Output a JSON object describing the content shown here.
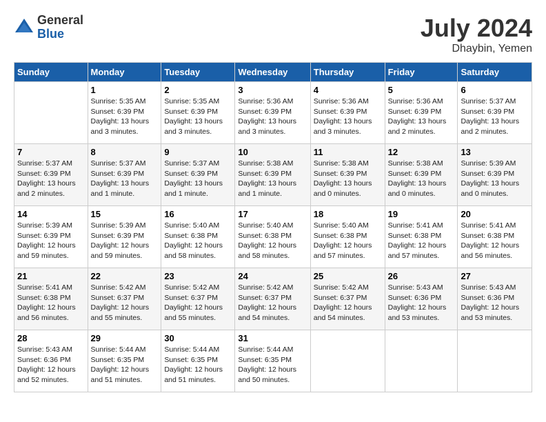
{
  "header": {
    "logo_general": "General",
    "logo_blue": "Blue",
    "month_year": "July 2024",
    "location": "Dhaybin, Yemen"
  },
  "days_of_week": [
    "Sunday",
    "Monday",
    "Tuesday",
    "Wednesday",
    "Thursday",
    "Friday",
    "Saturday"
  ],
  "weeks": [
    [
      {
        "day": "",
        "info": ""
      },
      {
        "day": "1",
        "info": "Sunrise: 5:35 AM\nSunset: 6:39 PM\nDaylight: 13 hours\nand 3 minutes."
      },
      {
        "day": "2",
        "info": "Sunrise: 5:35 AM\nSunset: 6:39 PM\nDaylight: 13 hours\nand 3 minutes."
      },
      {
        "day": "3",
        "info": "Sunrise: 5:36 AM\nSunset: 6:39 PM\nDaylight: 13 hours\nand 3 minutes."
      },
      {
        "day": "4",
        "info": "Sunrise: 5:36 AM\nSunset: 6:39 PM\nDaylight: 13 hours\nand 3 minutes."
      },
      {
        "day": "5",
        "info": "Sunrise: 5:36 AM\nSunset: 6:39 PM\nDaylight: 13 hours\nand 2 minutes."
      },
      {
        "day": "6",
        "info": "Sunrise: 5:37 AM\nSunset: 6:39 PM\nDaylight: 13 hours\nand 2 minutes."
      }
    ],
    [
      {
        "day": "7",
        "info": "Sunrise: 5:37 AM\nSunset: 6:39 PM\nDaylight: 13 hours\nand 2 minutes."
      },
      {
        "day": "8",
        "info": "Sunrise: 5:37 AM\nSunset: 6:39 PM\nDaylight: 13 hours\nand 1 minute."
      },
      {
        "day": "9",
        "info": "Sunrise: 5:37 AM\nSunset: 6:39 PM\nDaylight: 13 hours\nand 1 minute."
      },
      {
        "day": "10",
        "info": "Sunrise: 5:38 AM\nSunset: 6:39 PM\nDaylight: 13 hours\nand 1 minute."
      },
      {
        "day": "11",
        "info": "Sunrise: 5:38 AM\nSunset: 6:39 PM\nDaylight: 13 hours\nand 0 minutes."
      },
      {
        "day": "12",
        "info": "Sunrise: 5:38 AM\nSunset: 6:39 PM\nDaylight: 13 hours\nand 0 minutes."
      },
      {
        "day": "13",
        "info": "Sunrise: 5:39 AM\nSunset: 6:39 PM\nDaylight: 13 hours\nand 0 minutes."
      }
    ],
    [
      {
        "day": "14",
        "info": "Sunrise: 5:39 AM\nSunset: 6:39 PM\nDaylight: 12 hours\nand 59 minutes."
      },
      {
        "day": "15",
        "info": "Sunrise: 5:39 AM\nSunset: 6:39 PM\nDaylight: 12 hours\nand 59 minutes."
      },
      {
        "day": "16",
        "info": "Sunrise: 5:40 AM\nSunset: 6:38 PM\nDaylight: 12 hours\nand 58 minutes."
      },
      {
        "day": "17",
        "info": "Sunrise: 5:40 AM\nSunset: 6:38 PM\nDaylight: 12 hours\nand 58 minutes."
      },
      {
        "day": "18",
        "info": "Sunrise: 5:40 AM\nSunset: 6:38 PM\nDaylight: 12 hours\nand 57 minutes."
      },
      {
        "day": "19",
        "info": "Sunrise: 5:41 AM\nSunset: 6:38 PM\nDaylight: 12 hours\nand 57 minutes."
      },
      {
        "day": "20",
        "info": "Sunrise: 5:41 AM\nSunset: 6:38 PM\nDaylight: 12 hours\nand 56 minutes."
      }
    ],
    [
      {
        "day": "21",
        "info": "Sunrise: 5:41 AM\nSunset: 6:38 PM\nDaylight: 12 hours\nand 56 minutes."
      },
      {
        "day": "22",
        "info": "Sunrise: 5:42 AM\nSunset: 6:37 PM\nDaylight: 12 hours\nand 55 minutes."
      },
      {
        "day": "23",
        "info": "Sunrise: 5:42 AM\nSunset: 6:37 PM\nDaylight: 12 hours\nand 55 minutes."
      },
      {
        "day": "24",
        "info": "Sunrise: 5:42 AM\nSunset: 6:37 PM\nDaylight: 12 hours\nand 54 minutes."
      },
      {
        "day": "25",
        "info": "Sunrise: 5:42 AM\nSunset: 6:37 PM\nDaylight: 12 hours\nand 54 minutes."
      },
      {
        "day": "26",
        "info": "Sunrise: 5:43 AM\nSunset: 6:36 PM\nDaylight: 12 hours\nand 53 minutes."
      },
      {
        "day": "27",
        "info": "Sunrise: 5:43 AM\nSunset: 6:36 PM\nDaylight: 12 hours\nand 53 minutes."
      }
    ],
    [
      {
        "day": "28",
        "info": "Sunrise: 5:43 AM\nSunset: 6:36 PM\nDaylight: 12 hours\nand 52 minutes."
      },
      {
        "day": "29",
        "info": "Sunrise: 5:44 AM\nSunset: 6:35 PM\nDaylight: 12 hours\nand 51 minutes."
      },
      {
        "day": "30",
        "info": "Sunrise: 5:44 AM\nSunset: 6:35 PM\nDaylight: 12 hours\nand 51 minutes."
      },
      {
        "day": "31",
        "info": "Sunrise: 5:44 AM\nSunset: 6:35 PM\nDaylight: 12 hours\nand 50 minutes."
      },
      {
        "day": "",
        "info": ""
      },
      {
        "day": "",
        "info": ""
      },
      {
        "day": "",
        "info": ""
      }
    ]
  ]
}
